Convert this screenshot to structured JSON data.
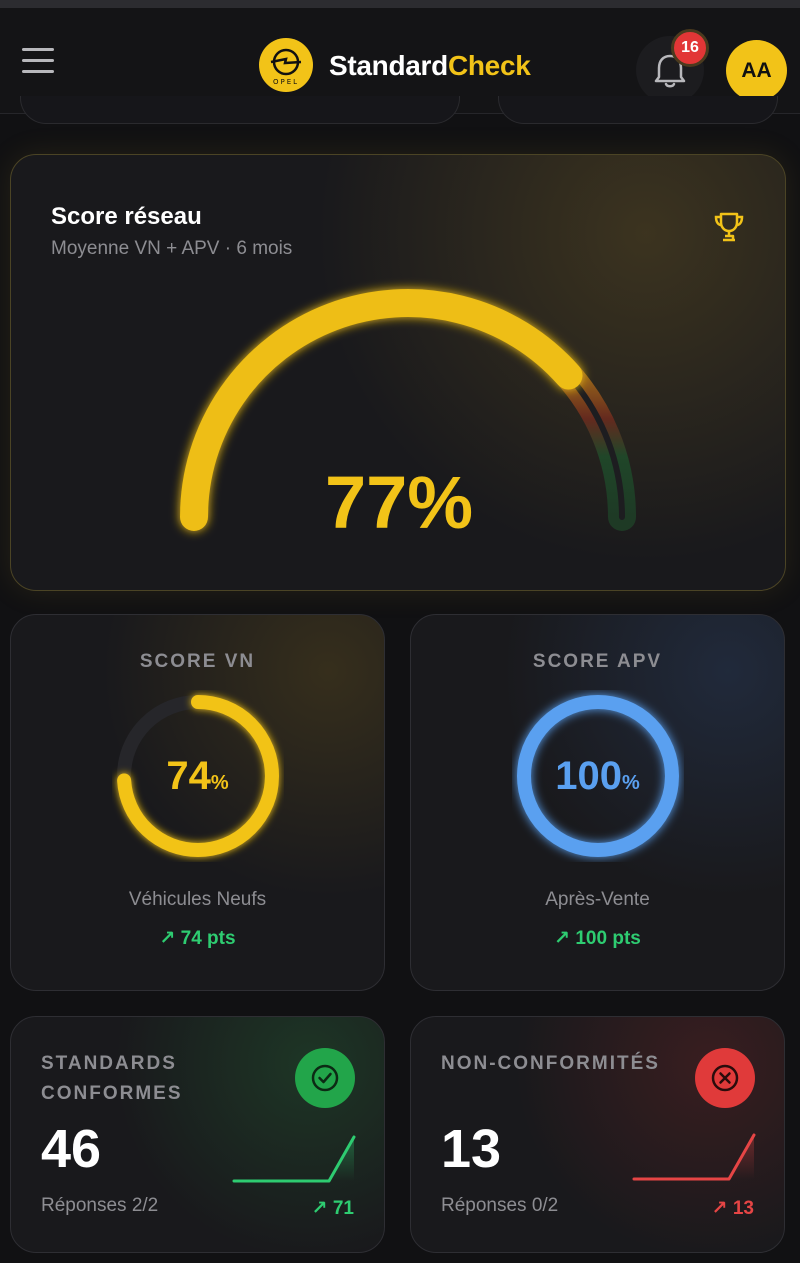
{
  "header": {
    "brand_part1": "Standard",
    "brand_part2": "Check",
    "notification_count": "16",
    "avatar_initials": "AA",
    "accent": "#f2c318"
  },
  "score_card": {
    "title": "Score réseau",
    "subtitle": "Moyenne VN + APV · 6 mois",
    "value": "77%",
    "value_fraction": 0.77
  },
  "vn": {
    "label": "SCORE VN",
    "value": "74",
    "unit": "%",
    "fraction": 0.74,
    "description": "Véhicules Neufs",
    "trend": "74 pts",
    "color": "#f2c318"
  },
  "apv": {
    "label": "SCORE APV",
    "value": "100",
    "unit": "%",
    "fraction": 1.0,
    "description": "Après-Vente",
    "trend": "100 pts",
    "color": "#5aa0f0"
  },
  "standards": {
    "label": "STANDARDS CONFORMES",
    "value": "46",
    "sub": "Réponses 2/2",
    "trend": "71",
    "color": "#2ecc71"
  },
  "non_conformites": {
    "label": "NON-CONFORMITÉS",
    "value": "13",
    "sub": "Réponses 0/2",
    "trend": "13",
    "color": "#e64545"
  }
}
